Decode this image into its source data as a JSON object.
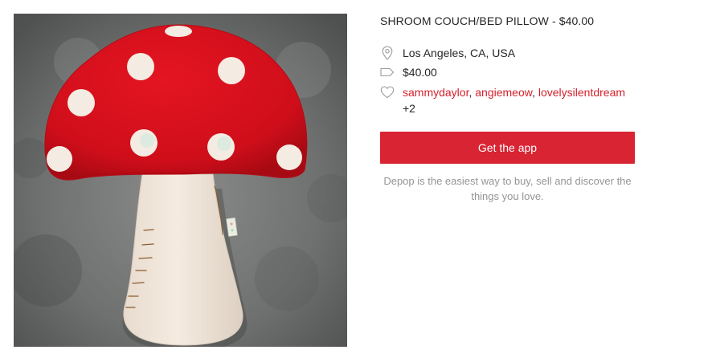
{
  "product": {
    "title": "SHROOM COUCH/BED PILLOW - $40.00",
    "image_subject": "red-and-white-mushroom-pillow-photo",
    "location": "Los Angeles, CA, USA",
    "price": "$40.00",
    "likes": {
      "users": [
        "sammydaylor",
        "angiemeow",
        "lovelysilentdream"
      ],
      "separator": ", ",
      "more": "+2"
    }
  },
  "cta": {
    "label": "Get the app"
  },
  "tagline": "Depop is the easiest way to buy, sell and discover the things you love.",
  "icons": {
    "location": "location-pin-icon",
    "price": "price-tag-icon",
    "likes": "heart-icon"
  },
  "colors": {
    "accent": "#d82433",
    "link": "#d4202c",
    "muted": "#959595",
    "text": "#262626",
    "cap_red": "#d5101c",
    "stem_cream": "#f2e6da"
  }
}
